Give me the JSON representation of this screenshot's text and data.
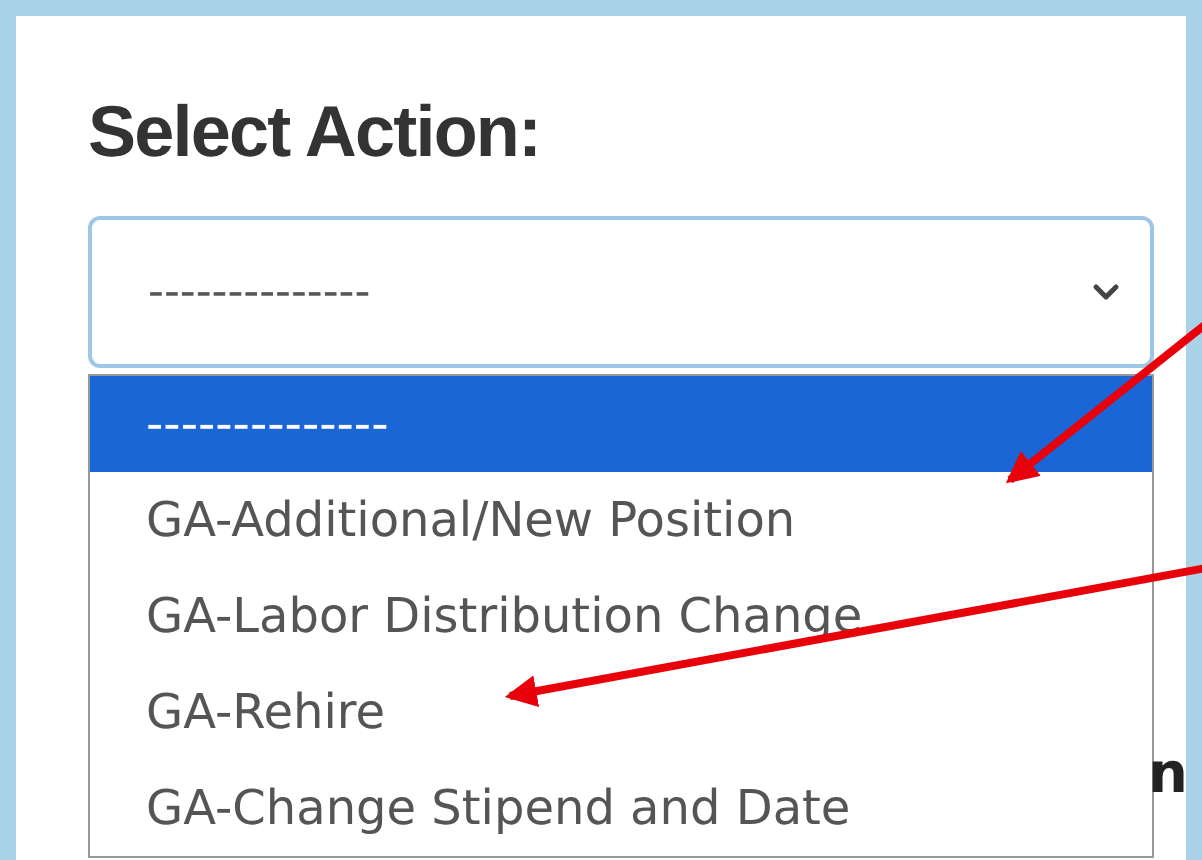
{
  "heading": "Select Action:",
  "select": {
    "value": "--------------",
    "expanded": true
  },
  "options": [
    {
      "label": "--------------",
      "selected": true
    },
    {
      "label": "GA-Additional/New Position",
      "selected": false
    },
    {
      "label": "GA-Labor Distribution Change",
      "selected": false
    },
    {
      "label": "GA-Rehire",
      "selected": false
    },
    {
      "label": "GA-Change Stipend and Date",
      "selected": false
    }
  ],
  "background_text": "n"
}
